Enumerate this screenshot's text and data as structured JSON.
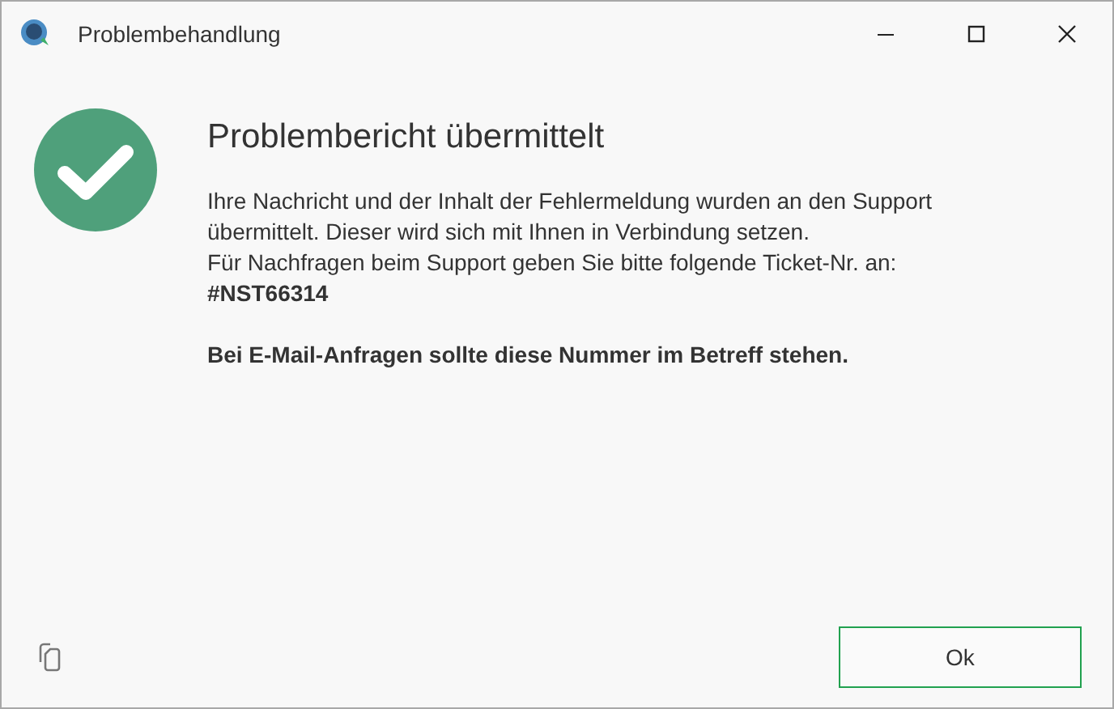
{
  "window": {
    "title": "Problembehandlung"
  },
  "message": {
    "heading": "Problembericht übermittelt",
    "lines": [
      "Ihre Nachricht und der Inhalt der Fehlermeldung wurden an den Support",
      "übermittelt. Dieser wird sich mit Ihnen in Verbindung setzen.",
      "Für Nachfragen beim Support geben Sie bitte folgende Ticket-Nr. an:"
    ],
    "ticket": "#NST66314",
    "note": "Bei E-Mail-Anfragen sollte diese Nummer im Betreff stehen."
  },
  "buttons": [
    "Ok"
  ]
}
